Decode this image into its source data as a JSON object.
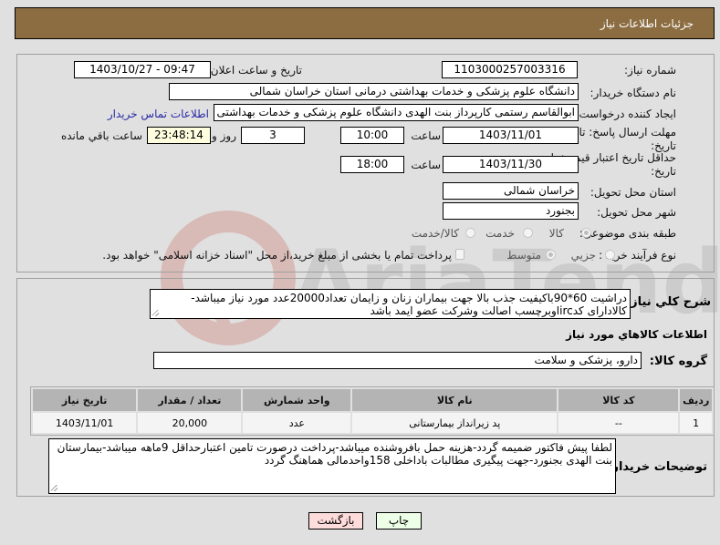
{
  "header": {
    "title": "جزئیات اطلاعات نیاز"
  },
  "form": {
    "need_number": {
      "label": "شماره نیاز:",
      "value": "1103000257003316"
    },
    "announce_datetime": {
      "label": "تاریخ و ساعت اعلان عمومی:",
      "value": "1403/10/27 - 09:47"
    },
    "buyer_org": {
      "label": "نام دستگاه خریدار:",
      "value": "دانشگاه علوم پزشکی و خدمات بهداشتی درمانی استان خراسان شمالی"
    },
    "requester": {
      "label": "ایجاد کننده درخواست:",
      "value": "ابوالقاسم رستمی کارپرداز بنت الهدی دانشگاه علوم پزشکی و خدمات بهداشتی",
      "contact_link": "اطلاعات تماس خریدار"
    },
    "response_deadline": {
      "label": "مهلت ارسال پاسخ: تا تاریخ:",
      "date": "1403/11/01",
      "time_label": "ساعت",
      "time": "10:00",
      "days": "3",
      "days_label": "روز و",
      "remaining": "23:48:14",
      "remaining_label": "ساعت باقي مانده"
    },
    "price_validity": {
      "label": "حداقل تاریخ اعتبار قیمت: تا تاریخ:",
      "date": "1403/11/30",
      "time_label": "ساعت",
      "time": "18:00"
    },
    "delivery_province": {
      "label": "استان محل تحویل:",
      "value": "خراسان شمالی"
    },
    "delivery_city": {
      "label": "شهر محل تحویل:",
      "value": "بجنورد"
    },
    "category": {
      "label": "طبقه بندی موضوعی:",
      "options": [
        "کالا",
        "خدمت",
        "کالا/خدمت"
      ],
      "selected": "کالا"
    },
    "purchase_type": {
      "label": "نوع فرآیند خرید :",
      "options": [
        "جزیي",
        "متوسط"
      ],
      "selected": "متوسط",
      "treasury_note": "پرداخت تمام یا بخشی از مبلغ خرید،از محل \"اسناد خزانه اسلامی\" خواهد بود."
    }
  },
  "description": {
    "label": "شرح کلي نیاز:",
    "value": "دراشیت 60*90باکیفیت جذب بالا جهت بیماران زنان و زایمان تعداد20000عدد مورد نیاز میباشد-کالادارای کدircاوبرچسب اصالت وشرکت عضو ایمد باشد"
  },
  "goods_section": {
    "title": "اطلاعات کالاهاي مورد نیاز",
    "group_label": "گروه کالا:",
    "group_value": "دارو، پزشکی و سلامت"
  },
  "items_table": {
    "columns": [
      "ردیف",
      "کد کالا",
      "نام کالا",
      "واحد شمارش",
      "تعداد / مقدار",
      "تاریخ نیاز"
    ],
    "rows": [
      [
        "1",
        "--",
        "پد زیرانداز بیمارستانی",
        "عدد",
        "20,000",
        "1403/11/01"
      ]
    ]
  },
  "buyer_notes": {
    "label": "توضیحات خریدار:",
    "value": "لطفا پیش فاکتور ضمیمه گردد-هزینه حمل بافروشنده میباشد-پرداخت درصورت تامین اعتبارحداقل 9ماهه میباشد-بیمارستان بنت الهدی بجنورد-جهت پیگیری مطالبات باداخلی 158واحدمالی هماهنگ گردد"
  },
  "buttons": {
    "print": "چاپ",
    "back": "بازگشت"
  },
  "watermark": {
    "text": "AriaTender.neT"
  },
  "colors": {
    "header_bg": "#8c6d42",
    "print_bg": "#eeffe8",
    "back_bg": "#ffdcdc",
    "link": "#2a2aa8"
  }
}
